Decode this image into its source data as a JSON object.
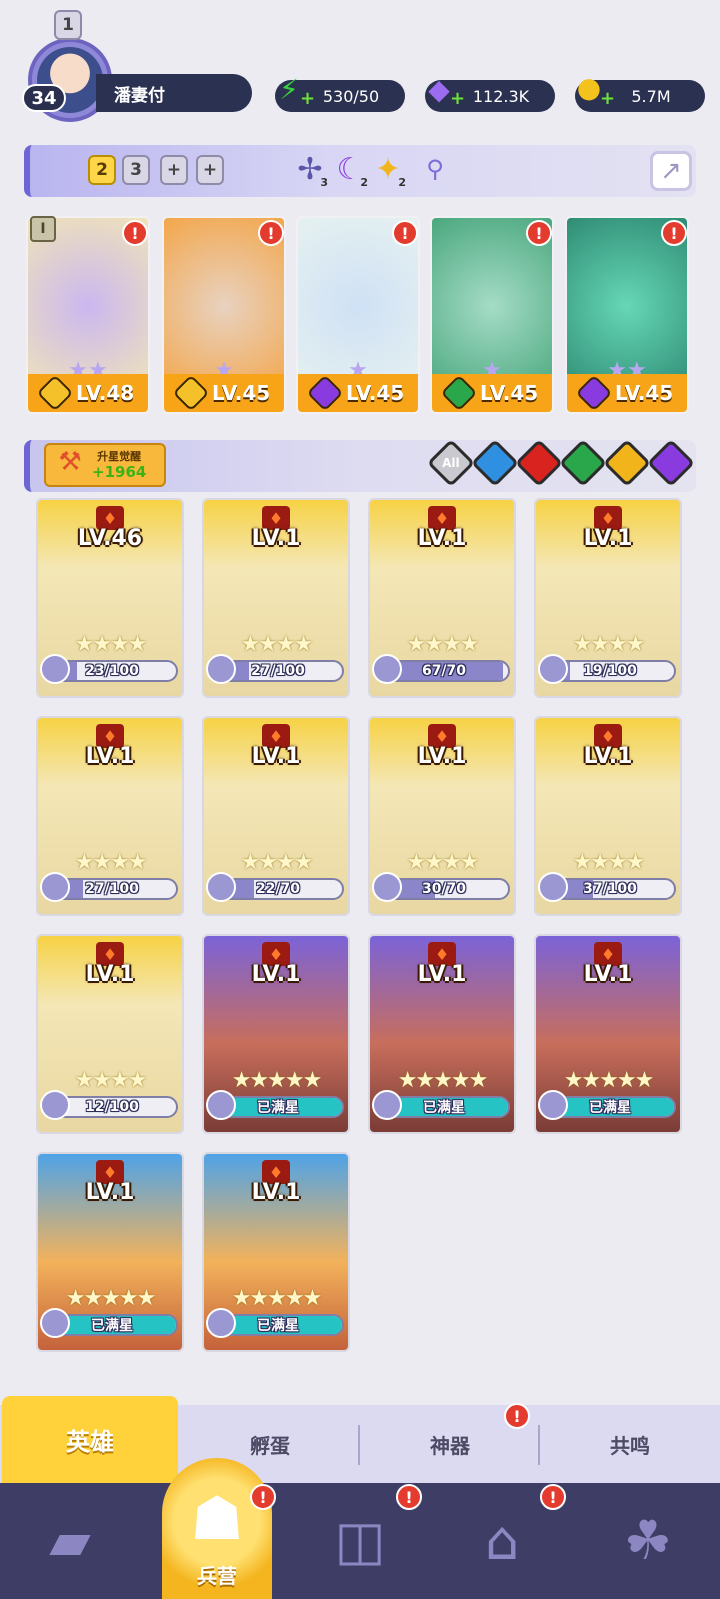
{
  "profile": {
    "level": "34",
    "name": "潘妻付"
  },
  "resources": [
    {
      "icon": "energy-icon",
      "value": "530/50",
      "color": "#39d13c"
    },
    {
      "icon": "gem-icon",
      "value": "112.3K",
      "color": "#9b6cf0"
    },
    {
      "icon": "coin-icon",
      "value": "5.7M",
      "color": "#f4c21d"
    }
  ],
  "team_bar": {
    "tabs": [
      "1",
      "2",
      "3",
      "+",
      "+"
    ],
    "active_tab": "2",
    "emblems": [
      {
        "icon": "crossbow-emblem-icon",
        "count": "3"
      },
      {
        "icon": "moon-emblem-icon",
        "count": "2"
      },
      {
        "icon": "sun-emblem-icon",
        "count": "2"
      }
    ]
  },
  "team": [
    {
      "level": "LV.48",
      "element": "light",
      "stars": 2,
      "art": [
        "#f0e4b8",
        "#cbb7f0"
      ]
    },
    {
      "level": "LV.45",
      "element": "light",
      "stars": 1,
      "art": [
        "#f3a64a",
        "#e8d2c0"
      ]
    },
    {
      "level": "LV.45",
      "element": "dark",
      "stars": 1,
      "art": [
        "#e6f1f0",
        "#cfe1f5"
      ]
    },
    {
      "level": "LV.45",
      "element": "wind",
      "stars": 1,
      "art": [
        "#4aa77d",
        "#a5dcc7"
      ]
    },
    {
      "level": "LV.45",
      "element": "dark",
      "stars": 2,
      "art": [
        "#2f8c74",
        "#66d7b7"
      ]
    }
  ],
  "filter": {
    "awaken_label": "升星觉醒",
    "awaken_value": "+1964",
    "options": [
      {
        "label": "All",
        "color": "#c9c9cf"
      },
      {
        "label": "",
        "color": "#2f8fe0"
      },
      {
        "label": "",
        "color": "#d8231f"
      },
      {
        "label": "",
        "color": "#2aa74a"
      },
      {
        "label": "",
        "color": "#f1b41b"
      },
      {
        "label": "",
        "color": "#8a3be0"
      }
    ]
  },
  "heroes": [
    {
      "level": "LV.46",
      "progress": "23/100",
      "frac": 0.23,
      "stars": 4,
      "rarity": "gold"
    },
    {
      "level": "LV.1",
      "progress": "27/100",
      "frac": 0.27,
      "stars": 4,
      "rarity": "gold"
    },
    {
      "level": "LV.1",
      "progress": "67/70",
      "frac": 0.96,
      "stars": 4,
      "rarity": "gold"
    },
    {
      "level": "LV.1",
      "progress": "19/100",
      "frac": 0.19,
      "stars": 4,
      "rarity": "gold"
    },
    {
      "level": "LV.1",
      "progress": "27/100",
      "frac": 0.27,
      "stars": 4,
      "rarity": "gold"
    },
    {
      "level": "LV.1",
      "progress": "22/70",
      "frac": 0.31,
      "stars": 4,
      "rarity": "gold"
    },
    {
      "level": "LV.1",
      "progress": "30/70",
      "frac": 0.43,
      "stars": 4,
      "rarity": "gold"
    },
    {
      "level": "LV.1",
      "progress": "37/100",
      "frac": 0.37,
      "stars": 4,
      "rarity": "gold"
    },
    {
      "level": "LV.1",
      "progress": "12/100",
      "frac": 0.12,
      "stars": 4,
      "rarity": "gold"
    },
    {
      "level": "LV.1",
      "progress": "已满星",
      "frac": 1,
      "stars": 5,
      "rarity": "purple"
    },
    {
      "level": "LV.1",
      "progress": "已满星",
      "frac": 1,
      "stars": 5,
      "rarity": "purple"
    },
    {
      "level": "LV.1",
      "progress": "已满星",
      "frac": 1,
      "stars": 5,
      "rarity": "purple"
    },
    {
      "level": "LV.1",
      "progress": "已满星",
      "frac": 1,
      "stars": 5,
      "rarity": "blue"
    },
    {
      "level": "LV.1",
      "progress": "已满星",
      "frac": 1,
      "stars": 5,
      "rarity": "blue"
    }
  ],
  "subtabs": [
    "英雄",
    "孵蛋",
    "神器",
    "共鸣"
  ],
  "nav": {
    "active_label": "兵营"
  }
}
